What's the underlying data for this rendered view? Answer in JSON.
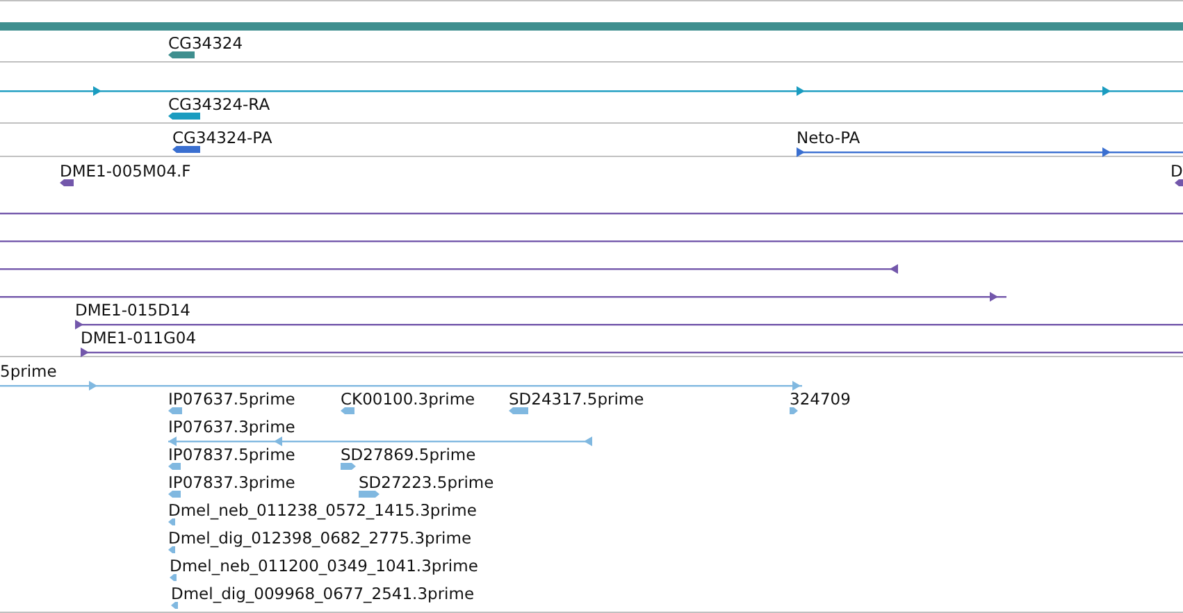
{
  "tracks": [
    {
      "color": "#3f8f8f",
      "rows": [
        {
          "features": [
            {
              "kind": "bar"
            }
          ]
        },
        {
          "features": [
            {
              "kind": "block",
              "label": "CG34324",
              "reverse": true
            }
          ]
        }
      ]
    },
    {
      "color": "#1a9cc0",
      "rows": [
        {
          "features": [
            {
              "kind": "span",
              "reverse": false
            }
          ]
        },
        {
          "features": [
            {
              "kind": "block",
              "label": "CG34324-RA",
              "reverse": true
            }
          ]
        }
      ]
    },
    {
      "color": "#3a6fd0",
      "rows": [
        {
          "features": [
            {
              "kind": "block",
              "label": "CG34324-PA",
              "reverse": true
            },
            {
              "kind": "span",
              "label": "Neto-PA",
              "reverse": false
            }
          ]
        }
      ]
    },
    {
      "color": "#7357ab",
      "rows": [
        {
          "features": [
            {
              "kind": "block",
              "label": "DME1-005M04.F",
              "reverse": true
            },
            {
              "kind": "block",
              "label": "D",
              "reverse": true
            }
          ]
        },
        {
          "features": [
            {
              "kind": "span"
            }
          ]
        },
        {
          "features": [
            {
              "kind": "span"
            }
          ]
        },
        {
          "features": [
            {
              "kind": "span",
              "reverse": true
            }
          ]
        },
        {
          "features": [
            {
              "kind": "span",
              "reverse": false
            }
          ]
        },
        {
          "features": [
            {
              "kind": "span",
              "label": "DME1-015D14",
              "reverse": false
            }
          ]
        },
        {
          "features": [
            {
              "kind": "span",
              "label": "DME1-011G04",
              "reverse": false
            }
          ]
        }
      ]
    },
    {
      "color": "#80b8e0",
      "rows": [
        {
          "features": [
            {
              "kind": "span",
              "label": "5prime",
              "reverse": false
            }
          ]
        },
        {
          "features": [
            {
              "kind": "block",
              "label": "IP07637.5prime",
              "reverse": true
            },
            {
              "kind": "block",
              "label": "CK00100.3prime",
              "reverse": true
            },
            {
              "kind": "block",
              "label": "SD24317.5prime",
              "reverse": true
            },
            {
              "kind": "block",
              "label": "324709",
              "reverse": false
            }
          ]
        },
        {
          "features": [
            {
              "kind": "span",
              "label": "IP07637.3prime",
              "reverse": true
            }
          ]
        },
        {
          "features": [
            {
              "kind": "block",
              "label": "IP07837.5prime",
              "reverse": true
            },
            {
              "kind": "block",
              "label": "SD27869.5prime",
              "reverse": false
            }
          ]
        },
        {
          "features": [
            {
              "kind": "block",
              "label": "IP07837.3prime",
              "reverse": true
            },
            {
              "kind": "block",
              "label": "SD27223.5prime",
              "reverse": false
            }
          ]
        },
        {
          "features": [
            {
              "kind": "block",
              "label": "Dmel_neb_011238_0572_1415.3prime",
              "reverse": true
            }
          ]
        },
        {
          "features": [
            {
              "kind": "block",
              "label": "Dmel_dig_012398_0682_2775.3prime",
              "reverse": true
            }
          ]
        },
        {
          "features": [
            {
              "kind": "block",
              "label": "Dmel_neb_011200_0349_1041.3prime",
              "reverse": true
            }
          ]
        },
        {
          "features": [
            {
              "kind": "block",
              "label": "Dmel_dig_009968_0677_2541.3prime",
              "reverse": true
            }
          ]
        }
      ]
    }
  ]
}
